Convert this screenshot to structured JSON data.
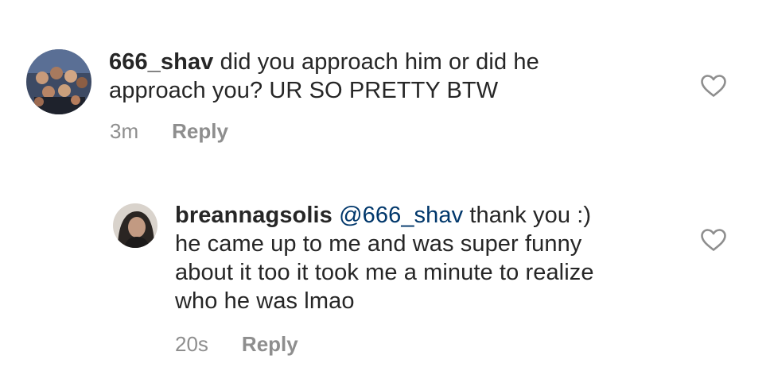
{
  "comments": [
    {
      "username": "666_shav",
      "line1": "did you approach him or did he",
      "line2": "approach you? UR SO PRETTY BTW",
      "time": "3m",
      "reply_label": "Reply"
    },
    {
      "username": "breannagsolis",
      "mention": "@666_shav",
      "line1": "thank you :)",
      "line2": "he came up to me and was super funny",
      "line3": "about it too it took me a minute to realize",
      "line4": "who he was lmao",
      "time": "20s",
      "reply_label": "Reply"
    }
  ],
  "icons": {
    "like": "heart-outline-icon"
  },
  "colors": {
    "text": "#262626",
    "meta": "#8e8e8e",
    "mention": "#00376b"
  }
}
